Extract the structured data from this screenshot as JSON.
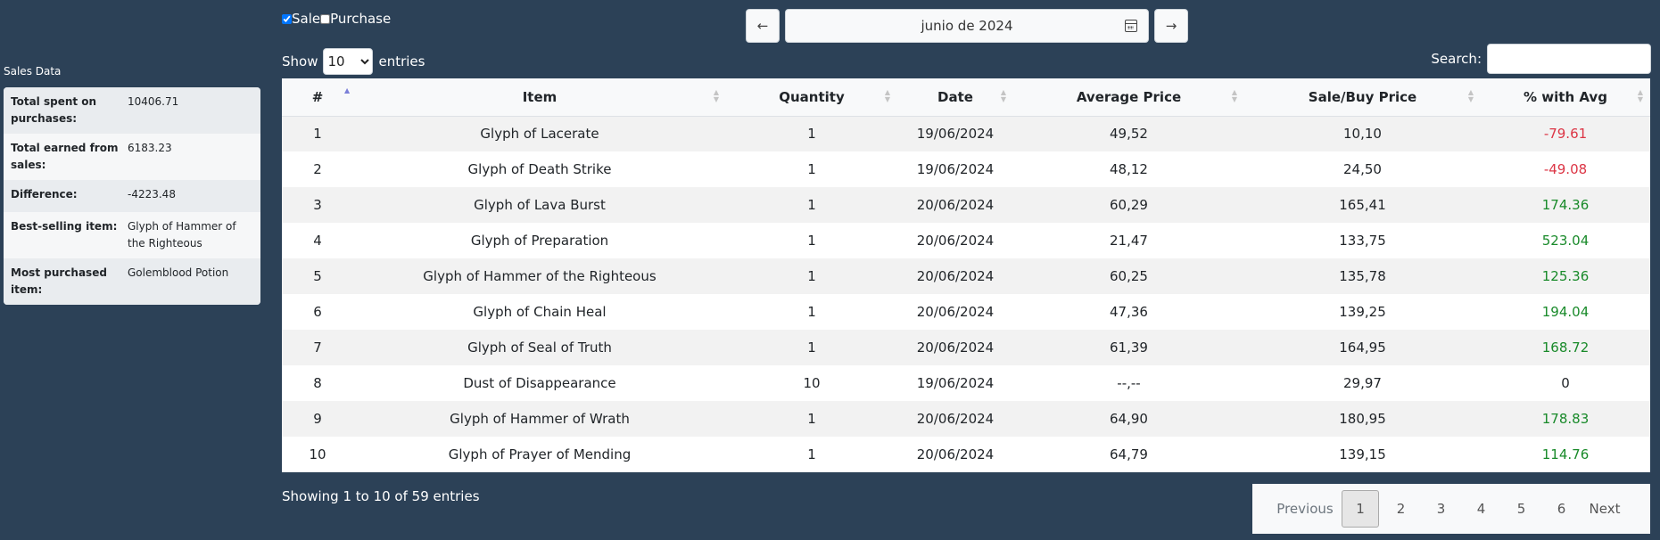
{
  "sidebar": {
    "title": "Sales Data",
    "summary": [
      {
        "label": "Total spent on purchases:",
        "value": "10406.71"
      },
      {
        "label": "Total earned from sales:",
        "value": "6183.23"
      },
      {
        "label": "Difference:",
        "value": "-4223.48"
      },
      {
        "label": "Best-selling item:",
        "value": "Glyph of Hammer of the Righteous"
      },
      {
        "label": "Most purchased item:",
        "value": "Golemblood Potion"
      }
    ]
  },
  "filters": {
    "sale_label": "Sale",
    "sale_checked": true,
    "purchase_label": "Purchase",
    "purchase_checked": false
  },
  "month_nav": {
    "prev": "←",
    "month": "junio de 2024",
    "next": "→"
  },
  "length_menu": {
    "show": "Show",
    "selected": "10",
    "entries": "entries"
  },
  "search": {
    "label": "Search:",
    "value": ""
  },
  "table": {
    "columns": [
      "#",
      "Item",
      "Quantity",
      "Date",
      "Average Price",
      "Sale/Buy Price",
      "% with Avg"
    ],
    "rows": [
      [
        "1",
        "Glyph of Lacerate",
        "1",
        "19/06/2024",
        "49,52",
        "10,10",
        "-79.61"
      ],
      [
        "2",
        "Glyph of Death Strike",
        "1",
        "19/06/2024",
        "48,12",
        "24,50",
        "-49.08"
      ],
      [
        "3",
        "Glyph of Lava Burst",
        "1",
        "20/06/2024",
        "60,29",
        "165,41",
        "174.36"
      ],
      [
        "4",
        "Glyph of Preparation",
        "1",
        "20/06/2024",
        "21,47",
        "133,75",
        "523.04"
      ],
      [
        "5",
        "Glyph of Hammer of the Righteous",
        "1",
        "20/06/2024",
        "60,25",
        "135,78",
        "125.36"
      ],
      [
        "6",
        "Glyph of Chain Heal",
        "1",
        "20/06/2024",
        "47,36",
        "139,25",
        "194.04"
      ],
      [
        "7",
        "Glyph of Seal of Truth",
        "1",
        "20/06/2024",
        "61,39",
        "164,95",
        "168.72"
      ],
      [
        "8",
        "Dust of Disappearance",
        "10",
        "19/06/2024",
        "--,--",
        "29,97",
        "0"
      ],
      [
        "9",
        "Glyph of Hammer of Wrath",
        "1",
        "20/06/2024",
        "64,90",
        "180,95",
        "178.83"
      ],
      [
        "10",
        "Glyph of Prayer of Mending",
        "1",
        "20/06/2024",
        "64,79",
        "139,15",
        "114.76"
      ]
    ]
  },
  "footer": {
    "info": "Showing 1 to 10 of 59 entries",
    "pagination": {
      "previous": "Previous",
      "pages": [
        "1",
        "2",
        "3",
        "4",
        "5",
        "6"
      ],
      "active_page": "1",
      "next": "Next"
    }
  },
  "colors": {
    "background": "#2c4157",
    "negative": "#dc3545",
    "positive": "#198a2a"
  }
}
